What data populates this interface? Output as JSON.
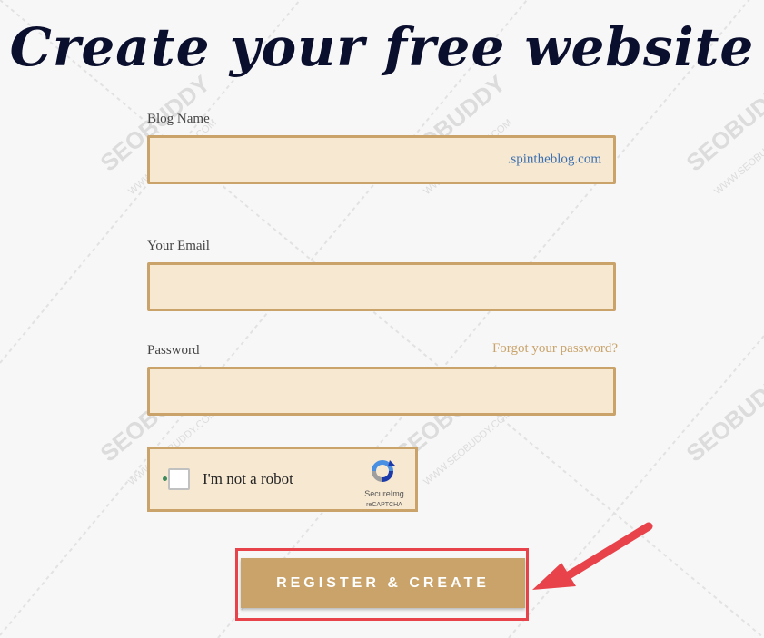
{
  "title": "Create your free website",
  "blog_name": {
    "label": "Blog Name",
    "value": "",
    "suffix": ".spintheblog.com"
  },
  "email": {
    "label": "Your Email",
    "value": ""
  },
  "password": {
    "label": "Password",
    "value": "",
    "forgot_link": "Forgot your password?"
  },
  "captcha": {
    "label": "I'm not a robot",
    "brand": "SecureImg",
    "privacy": "reCAPTCHA",
    "checked": false
  },
  "register_button": {
    "label": "REGISTER & CREATE"
  },
  "watermark": {
    "text": "SEOBUDDY",
    "subtext": "WWW.SEOBUDDY.COM"
  },
  "colors": {
    "title": "#0b0f2e",
    "field_border": "#c9a36a",
    "field_bg": "#f7e8d1",
    "button_bg": "#c9a36a",
    "link": "#3a6fb0",
    "annotation_red": "#e8434b"
  },
  "annotations": {
    "arrow_icon": "red-arrow-icon",
    "highlight": "red-highlight-box"
  }
}
